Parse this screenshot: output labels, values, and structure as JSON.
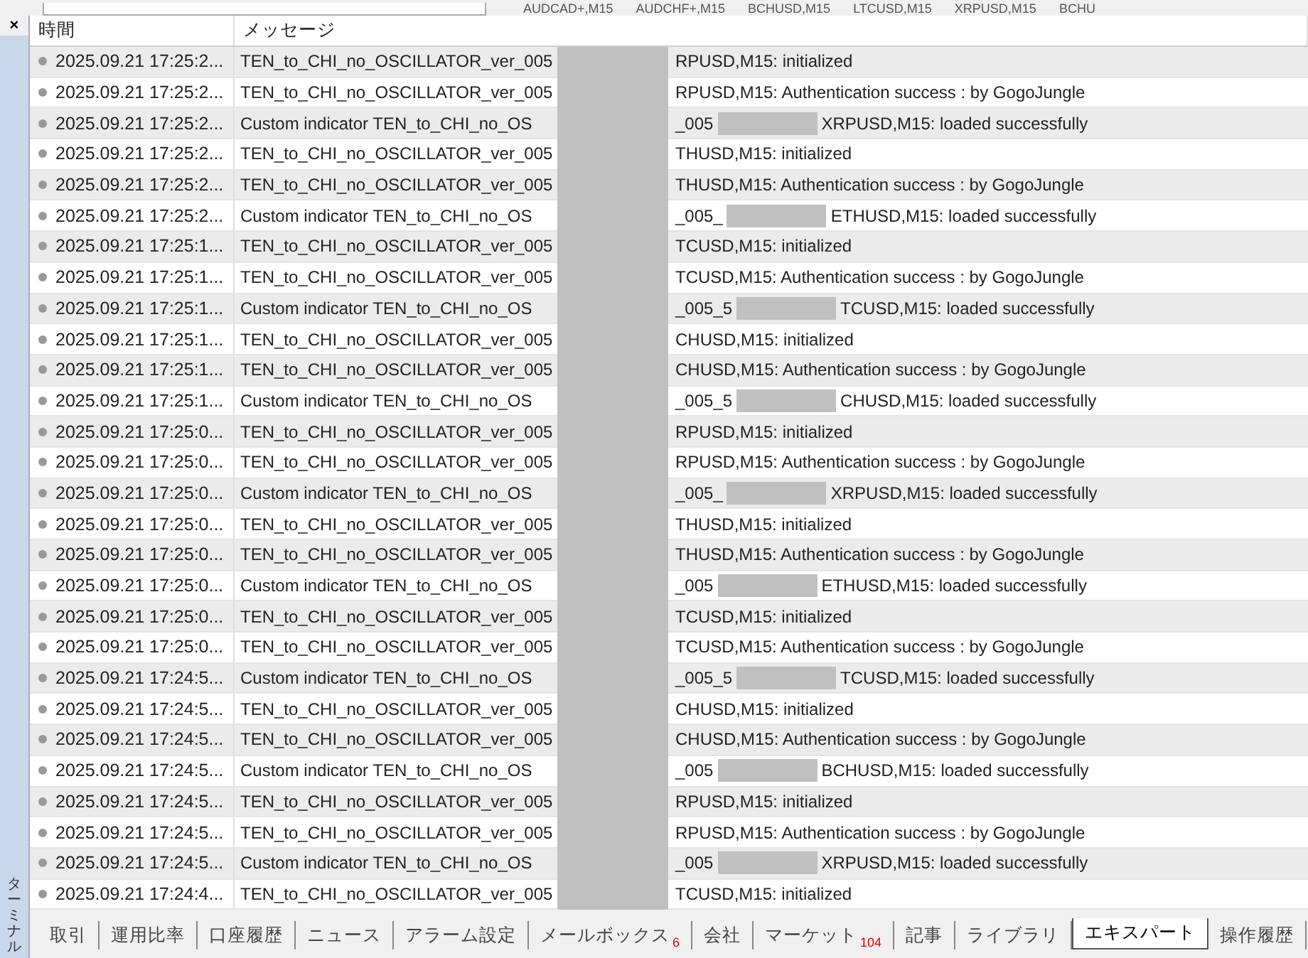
{
  "chart_tabs": [
    "AUDCAD+,M15",
    "AUDCHF+,M15",
    "BCHUSD,M15",
    "LTCUSD,M15",
    "XRPUSD,M15",
    "BCHU"
  ],
  "terminal": {
    "close": "×",
    "label": "ターミナル",
    "columns": [
      "時間",
      "メッセージ"
    ],
    "rows": [
      {
        "time": "2025.09.21 17:25:2...",
        "kind": "plain",
        "start": "TEN_to_CHI_no_OSCILLATOR_ver_005",
        "end": "RPUSD,M15: initialized"
      },
      {
        "time": "2025.09.21 17:25:2...",
        "kind": "plain",
        "start": "TEN_to_CHI_no_OSCILLATOR_ver_005",
        "end": "RPUSD,M15: Authentication success : by GogoJungle"
      },
      {
        "time": "2025.09.21 17:25:2...",
        "kind": "split",
        "start": "Custom indicator TEN_to_CHI_no_OS",
        "prefix": "_005",
        "end": "XRPUSD,M15: loaded successfully"
      },
      {
        "time": "2025.09.21 17:25:2...",
        "kind": "plain",
        "start": "TEN_to_CHI_no_OSCILLATOR_ver_005",
        "end": "THUSD,M15: initialized"
      },
      {
        "time": "2025.09.21 17:25:2...",
        "kind": "plain",
        "start": "TEN_to_CHI_no_OSCILLATOR_ver_005",
        "end": "THUSD,M15: Authentication success : by GogoJungle"
      },
      {
        "time": "2025.09.21 17:25:2...",
        "kind": "split",
        "start": "Custom indicator TEN_to_CHI_no_OS",
        "prefix": "_005_",
        "end": "ETHUSD,M15: loaded successfully"
      },
      {
        "time": "2025.09.21 17:25:1...",
        "kind": "plain",
        "start": "TEN_to_CHI_no_OSCILLATOR_ver_005",
        "end": "TCUSD,M15: initialized"
      },
      {
        "time": "2025.09.21 17:25:1...",
        "kind": "plain",
        "start": "TEN_to_CHI_no_OSCILLATOR_ver_005",
        "end": "TCUSD,M15: Authentication success : by GogoJungle"
      },
      {
        "time": "2025.09.21 17:25:1...",
        "kind": "split",
        "start": "Custom indicator TEN_to_CHI_no_OS",
        "prefix": "_005_5",
        "end": "TCUSD,M15: loaded successfully"
      },
      {
        "time": "2025.09.21 17:25:1...",
        "kind": "plain",
        "start": "TEN_to_CHI_no_OSCILLATOR_ver_005",
        "end": "CHUSD,M15: initialized"
      },
      {
        "time": "2025.09.21 17:25:1...",
        "kind": "plain",
        "start": "TEN_to_CHI_no_OSCILLATOR_ver_005",
        "end": "CHUSD,M15: Authentication success : by GogoJungle"
      },
      {
        "time": "2025.09.21 17:25:1...",
        "kind": "split",
        "start": "Custom indicator TEN_to_CHI_no_OS",
        "prefix": "_005_5",
        "end": "CHUSD,M15: loaded successfully"
      },
      {
        "time": "2025.09.21 17:25:0...",
        "kind": "plain",
        "start": "TEN_to_CHI_no_OSCILLATOR_ver_005",
        "end": "RPUSD,M15: initialized"
      },
      {
        "time": "2025.09.21 17:25:0...",
        "kind": "plain",
        "start": "TEN_to_CHI_no_OSCILLATOR_ver_005",
        "end": "RPUSD,M15: Authentication success : by GogoJungle"
      },
      {
        "time": "2025.09.21 17:25:0...",
        "kind": "split",
        "start": "Custom indicator TEN_to_CHI_no_OS",
        "prefix": "_005_",
        "end": "XRPUSD,M15: loaded successfully"
      },
      {
        "time": "2025.09.21 17:25:0...",
        "kind": "plain",
        "start": "TEN_to_CHI_no_OSCILLATOR_ver_005",
        "end": "THUSD,M15: initialized"
      },
      {
        "time": "2025.09.21 17:25:0...",
        "kind": "plain",
        "start": "TEN_to_CHI_no_OSCILLATOR_ver_005",
        "end": "THUSD,M15: Authentication success : by GogoJungle"
      },
      {
        "time": "2025.09.21 17:25:0...",
        "kind": "split",
        "start": "Custom indicator TEN_to_CHI_no_OS",
        "prefix": "_005",
        "end": "ETHUSD,M15: loaded successfully"
      },
      {
        "time": "2025.09.21 17:25:0...",
        "kind": "plain",
        "start": "TEN_to_CHI_no_OSCILLATOR_ver_005",
        "end": "TCUSD,M15: initialized"
      },
      {
        "time": "2025.09.21 17:25:0...",
        "kind": "plain",
        "start": "TEN_to_CHI_no_OSCILLATOR_ver_005",
        "end": "TCUSD,M15: Authentication success : by GogoJungle"
      },
      {
        "time": "2025.09.21 17:24:5...",
        "kind": "split",
        "start": "Custom indicator TEN_to_CHI_no_OS",
        "prefix": "_005_5",
        "end": "TCUSD,M15: loaded successfully"
      },
      {
        "time": "2025.09.21 17:24:5...",
        "kind": "plain",
        "start": "TEN_to_CHI_no_OSCILLATOR_ver_005",
        "end": "CHUSD,M15: initialized"
      },
      {
        "time": "2025.09.21 17:24:5...",
        "kind": "plain",
        "start": "TEN_to_CHI_no_OSCILLATOR_ver_005",
        "end": "CHUSD,M15: Authentication success : by GogoJungle"
      },
      {
        "time": "2025.09.21 17:24:5...",
        "kind": "split",
        "start": "Custom indicator TEN_to_CHI_no_OS",
        "prefix": "_005",
        "end": "BCHUSD,M15: loaded successfully"
      },
      {
        "time": "2025.09.21 17:24:5...",
        "kind": "plain",
        "start": "TEN_to_CHI_no_OSCILLATOR_ver_005",
        "end": "RPUSD,M15: initialized"
      },
      {
        "time": "2025.09.21 17:24:5...",
        "kind": "plain",
        "start": "TEN_to_CHI_no_OSCILLATOR_ver_005",
        "end": "RPUSD,M15: Authentication success : by GogoJungle"
      },
      {
        "time": "2025.09.21 17:24:5...",
        "kind": "split",
        "start": "Custom indicator TEN_to_CHI_no_OS",
        "prefix": "_005",
        "end": "XRPUSD,M15: loaded successfully"
      },
      {
        "time": "2025.09.21 17:24:4...",
        "kind": "plain",
        "start": "TEN_to_CHI_no_OSCILLATOR_ver_005",
        "end": "TCUSD,M15: initialized"
      }
    ],
    "tabs": [
      {
        "label": "取引",
        "selected": false
      },
      {
        "label": "運用比率",
        "selected": false
      },
      {
        "label": "口座履歴",
        "selected": false
      },
      {
        "label": "ニュース",
        "selected": false
      },
      {
        "label": "アラーム設定",
        "selected": false
      },
      {
        "label": "メールボックス",
        "badge": "6",
        "selected": false
      },
      {
        "label": "会社",
        "selected": false
      },
      {
        "label": "マーケット",
        "badge": "104",
        "selected": false
      },
      {
        "label": "記事",
        "selected": false
      },
      {
        "label": "ライブラリ",
        "selected": false
      },
      {
        "label": "エキスパート",
        "selected": true
      },
      {
        "label": "操作履歴",
        "selected": false
      }
    ]
  }
}
